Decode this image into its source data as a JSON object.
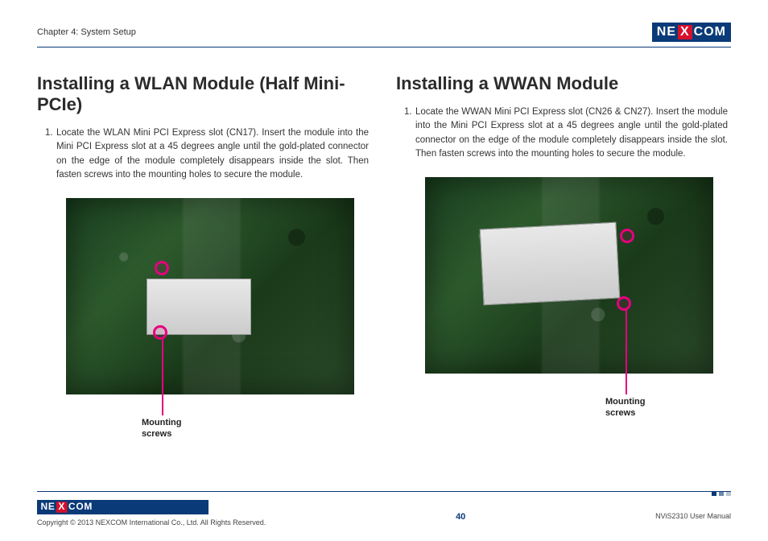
{
  "header": {
    "chapter": "Chapter 4: System Setup",
    "brand_left": "NE",
    "brand_x": "X",
    "brand_right": "COM"
  },
  "left": {
    "heading": "Installing a WLAN Module (Half Mini-PCIe)",
    "step_num": "1.",
    "step_text": "Locate the WLAN Mini PCI Express slot (CN17). Insert the module into the Mini PCI Express slot at a 45 degrees angle until the gold-plated connector on the edge of the module completely disappears inside the slot. Then fasten screws into the mounting holes to secure the module.",
    "callout": "Mounting\nscrews"
  },
  "right": {
    "heading": "Installing a WWAN Module",
    "step_num": "1.",
    "step_text": "Locate the WWAN Mini PCI Express slot (CN26 & CN27). Insert the module into the Mini PCI Express slot at a 45 degrees angle until the gold-plated connector on the edge of the module completely disappears inside the slot. Then fasten screws into the mounting holes to secure the module.",
    "callout": "Mounting\nscrews"
  },
  "footer": {
    "copyright": "Copyright © 2013 NEXCOM International Co., Ltd. All Rights Reserved.",
    "page": "40",
    "doc": "NViS2310 User Manual"
  }
}
